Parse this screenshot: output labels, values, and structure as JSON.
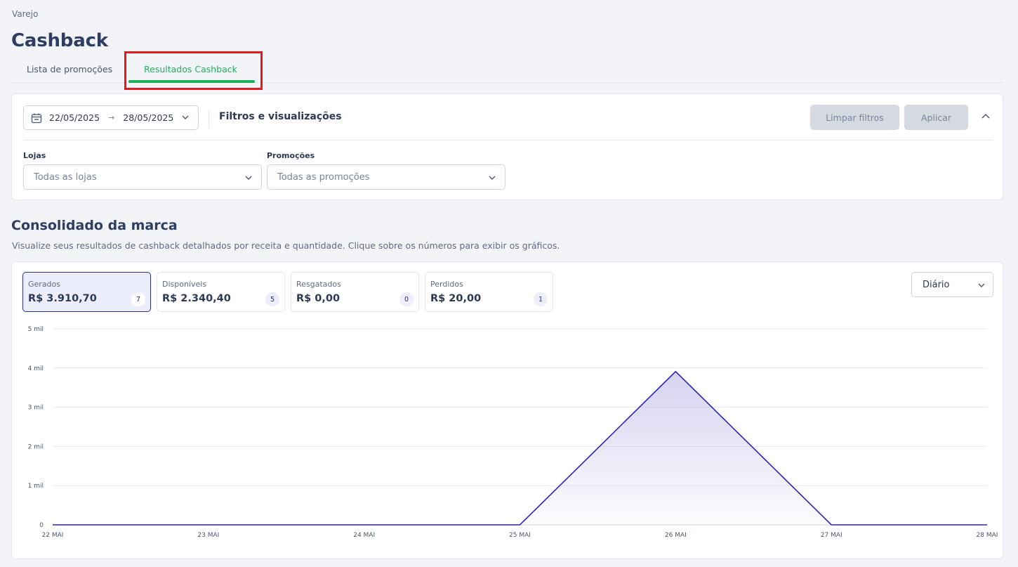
{
  "breadcrumb": "Varejo",
  "page_title": "Cashback",
  "tabs": [
    {
      "label": "Lista de promoções",
      "active": false
    },
    {
      "label": "Resultados Cashback",
      "active": true
    }
  ],
  "filters": {
    "date_start": "22/05/2025",
    "date_end": "28/05/2025",
    "date_arrow": "→",
    "title": "Filtros e visualizações",
    "clear_label": "Limpar filtros",
    "apply_label": "Aplicar",
    "stores_label": "Lojas",
    "stores_value": "Todas as lojas",
    "promos_label": "Promoções",
    "promos_value": "Todas as promoções"
  },
  "section": {
    "title": "Consolidado da marca",
    "description": "Visualize seus resultados de cashback detalhados por receita e quantidade. Clique sobre os números para exibir os gráficos."
  },
  "metrics": [
    {
      "label": "Gerados",
      "value": "R$ 3.910,70",
      "count": "7",
      "active": true
    },
    {
      "label": "Disponíveis",
      "value": "R$ 2.340,40",
      "count": "5",
      "active": false
    },
    {
      "label": "Resgatados",
      "value": "R$ 0,00",
      "count": "0",
      "active": false
    },
    {
      "label": "Perdidos",
      "value": "R$ 20,00",
      "count": "1",
      "active": false
    }
  ],
  "period": "Diário",
  "colors": {
    "accent": "#2c2c8a",
    "tab_active": "#20b05c",
    "highlight": "#e11b1b",
    "line": "#2d24b8"
  },
  "chart_data": {
    "type": "area",
    "title": "",
    "xlabel": "",
    "ylabel": "",
    "x": [
      "22 MAI",
      "23 MAI",
      "24 MAI",
      "25 MAI",
      "26 MAI",
      "27 MAI",
      "28 MAI"
    ],
    "series": [
      {
        "values": [
          0,
          0,
          0,
          0,
          3910.7,
          0,
          0
        ]
      }
    ],
    "y_ticks": [
      0,
      1000,
      2000,
      3000,
      4000,
      5000
    ],
    "y_tick_labels": [
      "0",
      "1 mil",
      "2 mil",
      "3 mil",
      "4 mil",
      "5 mil"
    ],
    "ylim": [
      0,
      5000
    ],
    "grid": true,
    "legend": "none"
  }
}
